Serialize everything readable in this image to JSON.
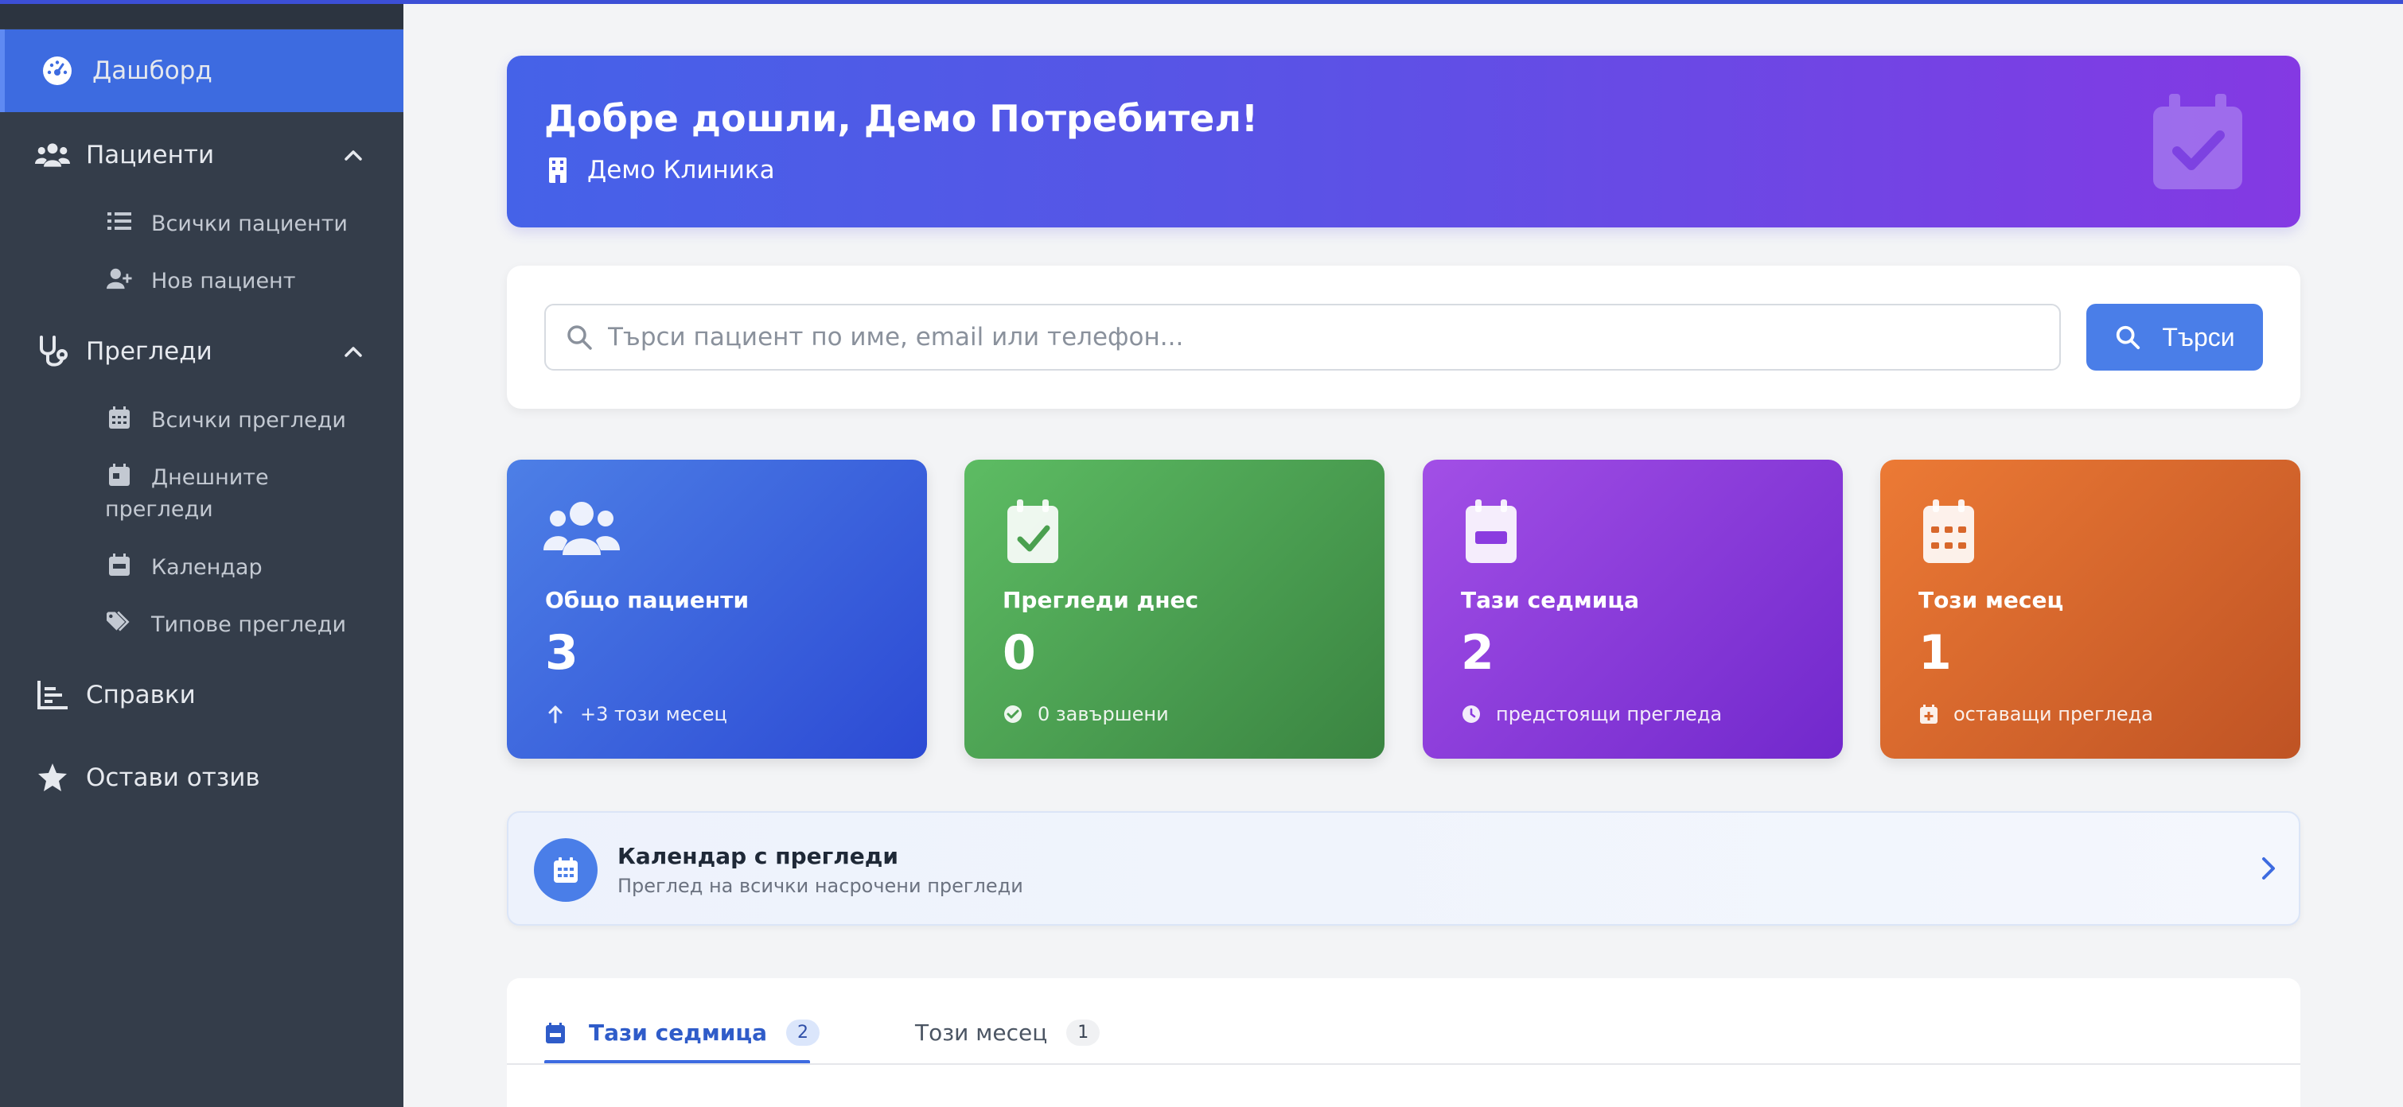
{
  "sidebar": {
    "dashboard": "Дашборд",
    "patients": {
      "label": "Пациенти",
      "items": [
        "Всички пациенти",
        "Нов пациент"
      ]
    },
    "exams": {
      "label": "Прегледи",
      "items": [
        "Всички прегледи",
        "Днешните",
        "прегледи",
        "Календар",
        "Типове прегледи"
      ]
    },
    "reports": "Справки",
    "feedback": "Остави отзив"
  },
  "banner": {
    "title": "Добре дошли, Демо Потребител!",
    "clinic": "Демо Клиника"
  },
  "search": {
    "placeholder": "Търси пациент по име, email или телефон...",
    "button": "Търси"
  },
  "stats": [
    {
      "label": "Общо пациенти",
      "value": "3",
      "sub": "+3 този месец",
      "color": "#3b62dc"
    },
    {
      "label": "Прегледи днес",
      "value": "0",
      "sub": "0 завършени",
      "color": "#4aa04f"
    },
    {
      "label": "Тази седмица",
      "value": "2",
      "sub": "предстоящи прегледа",
      "color": "#8b3ce0"
    },
    {
      "label": "Този месец",
      "value": "1",
      "sub": "оставащи прегледа",
      "color": "#d8672b"
    }
  ],
  "calendar_card": {
    "title": "Календар с прегледи",
    "description": "Преглед на всички насрочени прегледи"
  },
  "tabs": [
    {
      "label": "Тази седмица",
      "count": "2"
    },
    {
      "label": "Този месец",
      "count": "1"
    }
  ],
  "colors": {
    "accent": "#3d6be0",
    "sidebar": "#343d4a"
  }
}
